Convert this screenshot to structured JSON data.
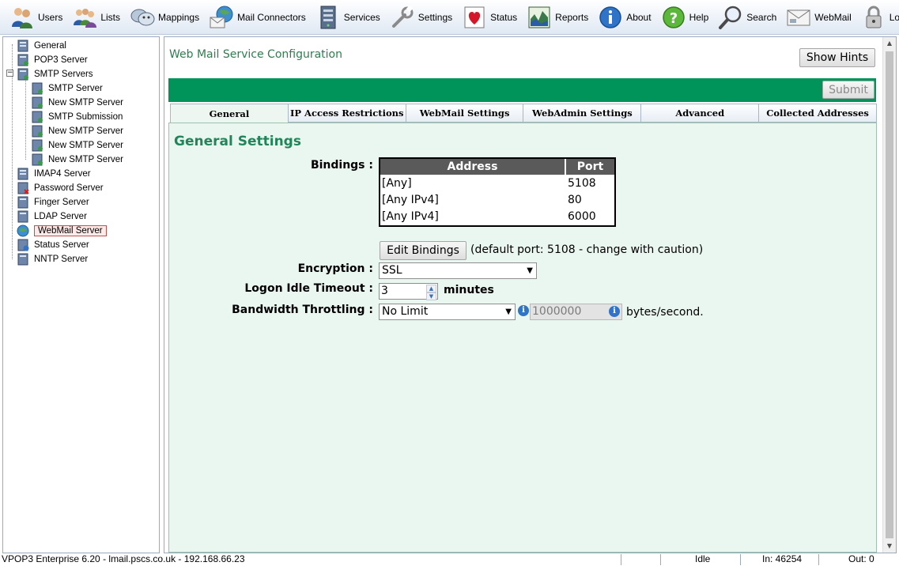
{
  "toolbar": {
    "items": [
      {
        "label": "Users",
        "icon": "users-icon"
      },
      {
        "label": "Lists",
        "icon": "lists-icon"
      },
      {
        "label": "Mappings",
        "icon": "mappings-icon"
      },
      {
        "label": "Mail Connectors",
        "icon": "mail-connectors-icon"
      },
      {
        "label": "Services",
        "icon": "services-icon"
      },
      {
        "label": "Settings",
        "icon": "settings-icon"
      },
      {
        "label": "Status",
        "icon": "status-icon"
      },
      {
        "label": "Reports",
        "icon": "reports-icon"
      },
      {
        "label": "About",
        "icon": "about-icon"
      },
      {
        "label": "Help",
        "icon": "help-icon"
      },
      {
        "label": "Search",
        "icon": "search-icon"
      },
      {
        "label": "WebMail",
        "icon": "webmail-icon"
      },
      {
        "label": "Logout",
        "icon": "logout-icon"
      }
    ]
  },
  "tree": {
    "items": [
      {
        "label": "General"
      },
      {
        "label": "POP3 Server"
      },
      {
        "label": "SMTP Servers"
      },
      {
        "label": "SMTP Server"
      },
      {
        "label": "New SMTP Server"
      },
      {
        "label": "SMTP Submission"
      },
      {
        "label": "New SMTP Server"
      },
      {
        "label": "New SMTP Server"
      },
      {
        "label": "New SMTP Server"
      },
      {
        "label": "IMAP4 Server"
      },
      {
        "label": "Password Server"
      },
      {
        "label": "Finger Server"
      },
      {
        "label": "LDAP Server"
      },
      {
        "label": "WebMail Server",
        "selected": true
      },
      {
        "label": "Status Server"
      },
      {
        "label": "NNTP Server"
      }
    ]
  },
  "main": {
    "title": "Web Mail Service Configuration",
    "show_hints": "Show Hints",
    "submit": "Submit",
    "tabs": [
      {
        "label": "General",
        "active": true
      },
      {
        "label": "IP Access Restrictions"
      },
      {
        "label": "WebMail Settings"
      },
      {
        "label": "WebAdmin Settings"
      },
      {
        "label": "Advanced"
      },
      {
        "label": "Collected Addresses"
      }
    ],
    "section_title": "General Settings",
    "bindings": {
      "label": "Bindings :",
      "columns": [
        "Address",
        "Port"
      ],
      "rows": [
        {
          "address": "[Any]",
          "port": "5108"
        },
        {
          "address": "[Any IPv4]",
          "port": "80"
        },
        {
          "address": "[Any IPv4]",
          "port": "6000"
        }
      ],
      "edit_button": "Edit Bindings",
      "note": "(default port: 5108 - change with caution)"
    },
    "encryption": {
      "label": "Encryption :",
      "value": "SSL"
    },
    "logon_idle": {
      "label": "Logon Idle Timeout :",
      "value": "3",
      "unit": "minutes"
    },
    "bandwidth": {
      "label": "Bandwidth Throttling :",
      "value": "No Limit",
      "amount": "1000000",
      "unit": "bytes/second."
    }
  },
  "status_bar": {
    "product": "VPOP3 Enterprise 6.20 - lmail.pscs.co.uk - 192.168.66.23",
    "state": "Idle",
    "in": "In: 46254",
    "out": "Out: 0"
  },
  "colors": {
    "accent_green": "#00935a",
    "title_green": "#22855a",
    "content_bg": "#eaf6f0"
  }
}
